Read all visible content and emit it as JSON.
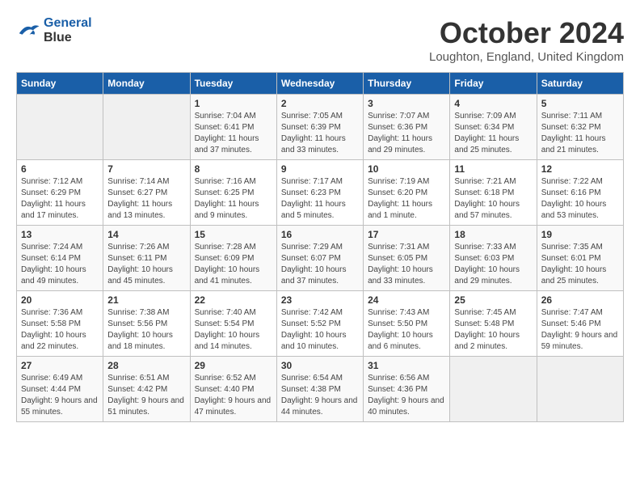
{
  "logo": {
    "line1": "General",
    "line2": "Blue"
  },
  "title": "October 2024",
  "location": "Loughton, England, United Kingdom",
  "weekdays": [
    "Sunday",
    "Monday",
    "Tuesday",
    "Wednesday",
    "Thursday",
    "Friday",
    "Saturday"
  ],
  "weeks": [
    [
      {
        "day": "",
        "info": ""
      },
      {
        "day": "",
        "info": ""
      },
      {
        "day": "1",
        "info": "Sunrise: 7:04 AM\nSunset: 6:41 PM\nDaylight: 11 hours and 37 minutes."
      },
      {
        "day": "2",
        "info": "Sunrise: 7:05 AM\nSunset: 6:39 PM\nDaylight: 11 hours and 33 minutes."
      },
      {
        "day": "3",
        "info": "Sunrise: 7:07 AM\nSunset: 6:36 PM\nDaylight: 11 hours and 29 minutes."
      },
      {
        "day": "4",
        "info": "Sunrise: 7:09 AM\nSunset: 6:34 PM\nDaylight: 11 hours and 25 minutes."
      },
      {
        "day": "5",
        "info": "Sunrise: 7:11 AM\nSunset: 6:32 PM\nDaylight: 11 hours and 21 minutes."
      }
    ],
    [
      {
        "day": "6",
        "info": "Sunrise: 7:12 AM\nSunset: 6:29 PM\nDaylight: 11 hours and 17 minutes."
      },
      {
        "day": "7",
        "info": "Sunrise: 7:14 AM\nSunset: 6:27 PM\nDaylight: 11 hours and 13 minutes."
      },
      {
        "day": "8",
        "info": "Sunrise: 7:16 AM\nSunset: 6:25 PM\nDaylight: 11 hours and 9 minutes."
      },
      {
        "day": "9",
        "info": "Sunrise: 7:17 AM\nSunset: 6:23 PM\nDaylight: 11 hours and 5 minutes."
      },
      {
        "day": "10",
        "info": "Sunrise: 7:19 AM\nSunset: 6:20 PM\nDaylight: 11 hours and 1 minute."
      },
      {
        "day": "11",
        "info": "Sunrise: 7:21 AM\nSunset: 6:18 PM\nDaylight: 10 hours and 57 minutes."
      },
      {
        "day": "12",
        "info": "Sunrise: 7:22 AM\nSunset: 6:16 PM\nDaylight: 10 hours and 53 minutes."
      }
    ],
    [
      {
        "day": "13",
        "info": "Sunrise: 7:24 AM\nSunset: 6:14 PM\nDaylight: 10 hours and 49 minutes."
      },
      {
        "day": "14",
        "info": "Sunrise: 7:26 AM\nSunset: 6:11 PM\nDaylight: 10 hours and 45 minutes."
      },
      {
        "day": "15",
        "info": "Sunrise: 7:28 AM\nSunset: 6:09 PM\nDaylight: 10 hours and 41 minutes."
      },
      {
        "day": "16",
        "info": "Sunrise: 7:29 AM\nSunset: 6:07 PM\nDaylight: 10 hours and 37 minutes."
      },
      {
        "day": "17",
        "info": "Sunrise: 7:31 AM\nSunset: 6:05 PM\nDaylight: 10 hours and 33 minutes."
      },
      {
        "day": "18",
        "info": "Sunrise: 7:33 AM\nSunset: 6:03 PM\nDaylight: 10 hours and 29 minutes."
      },
      {
        "day": "19",
        "info": "Sunrise: 7:35 AM\nSunset: 6:01 PM\nDaylight: 10 hours and 25 minutes."
      }
    ],
    [
      {
        "day": "20",
        "info": "Sunrise: 7:36 AM\nSunset: 5:58 PM\nDaylight: 10 hours and 22 minutes."
      },
      {
        "day": "21",
        "info": "Sunrise: 7:38 AM\nSunset: 5:56 PM\nDaylight: 10 hours and 18 minutes."
      },
      {
        "day": "22",
        "info": "Sunrise: 7:40 AM\nSunset: 5:54 PM\nDaylight: 10 hours and 14 minutes."
      },
      {
        "day": "23",
        "info": "Sunrise: 7:42 AM\nSunset: 5:52 PM\nDaylight: 10 hours and 10 minutes."
      },
      {
        "day": "24",
        "info": "Sunrise: 7:43 AM\nSunset: 5:50 PM\nDaylight: 10 hours and 6 minutes."
      },
      {
        "day": "25",
        "info": "Sunrise: 7:45 AM\nSunset: 5:48 PM\nDaylight: 10 hours and 2 minutes."
      },
      {
        "day": "26",
        "info": "Sunrise: 7:47 AM\nSunset: 5:46 PM\nDaylight: 9 hours and 59 minutes."
      }
    ],
    [
      {
        "day": "27",
        "info": "Sunrise: 6:49 AM\nSunset: 4:44 PM\nDaylight: 9 hours and 55 minutes."
      },
      {
        "day": "28",
        "info": "Sunrise: 6:51 AM\nSunset: 4:42 PM\nDaylight: 9 hours and 51 minutes."
      },
      {
        "day": "29",
        "info": "Sunrise: 6:52 AM\nSunset: 4:40 PM\nDaylight: 9 hours and 47 minutes."
      },
      {
        "day": "30",
        "info": "Sunrise: 6:54 AM\nSunset: 4:38 PM\nDaylight: 9 hours and 44 minutes."
      },
      {
        "day": "31",
        "info": "Sunrise: 6:56 AM\nSunset: 4:36 PM\nDaylight: 9 hours and 40 minutes."
      },
      {
        "day": "",
        "info": ""
      },
      {
        "day": "",
        "info": ""
      }
    ]
  ]
}
